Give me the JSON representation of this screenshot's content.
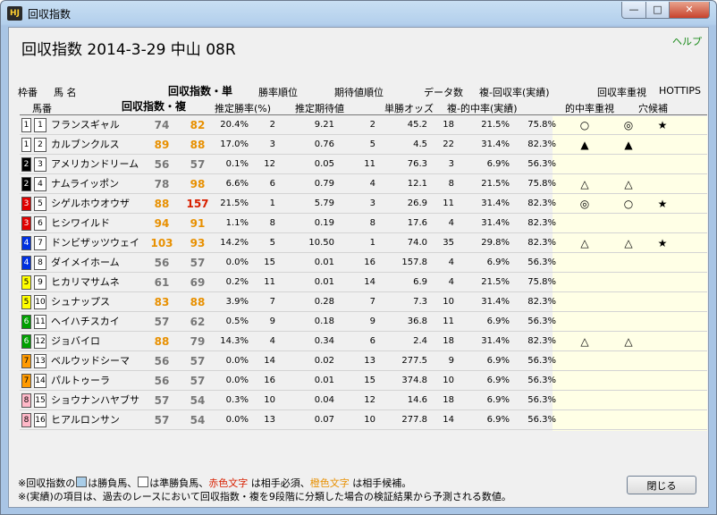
{
  "window": {
    "title": "回収指数",
    "icon_label": "HJ",
    "minimize": "—",
    "maximize": "□",
    "close": "✕"
  },
  "header": {
    "title": "回収指数  2014-3-29 中山 08R",
    "help": "ヘルプ"
  },
  "columns_top": {
    "waku": "枠番",
    "horse": "馬 名",
    "idx_single": "回収指数・単",
    "win_rank": "勝率順位",
    "exp_rank": "期待値順位",
    "data_count": "データ数",
    "place_recov": "複-回収率(実績)",
    "recov_focus": "回収率重視",
    "hottips": "HOTTIPS"
  },
  "columns_bottom": {
    "umaban": "馬番",
    "idx_place": "回収指数・複",
    "est_win": "推定勝率(%)",
    "est_exp": "推定期待値",
    "odds": "単勝オッズ",
    "place_hit": "複-的中率(実績)",
    "hit_focus": "的中率重視",
    "longshot": "穴候補"
  },
  "colors": {
    "red": "#d82000",
    "orange": "#e89000",
    "gray": "#777777"
  },
  "rows": [
    {
      "waku": "1",
      "waku_bg": "#ffffff",
      "waku_fg": "#000000",
      "umaban": "1",
      "name": "フランスギャル",
      "idx1": "74",
      "idx1_c": "gray",
      "idx2": "82",
      "idx2_c": "orange",
      "winp": "20.4%",
      "winr": "2",
      "exp": "9.21",
      "expr": "2",
      "odds": "45.2",
      "cnt": "18",
      "hit": "21.5%",
      "recov": "75.8%",
      "s1": "○",
      "s2": "◎",
      "s3": "★"
    },
    {
      "waku": "1",
      "waku_bg": "#ffffff",
      "waku_fg": "#000000",
      "umaban": "2",
      "name": "カルブンクルス",
      "idx1": "89",
      "idx1_c": "orange",
      "idx2": "88",
      "idx2_c": "orange",
      "winp": "17.0%",
      "winr": "3",
      "exp": "0.76",
      "expr": "5",
      "odds": "4.5",
      "cnt": "22",
      "hit": "31.4%",
      "recov": "82.3%",
      "s1": "▲",
      "s2": "▲",
      "s3": ""
    },
    {
      "waku": "2",
      "waku_bg": "#000000",
      "waku_fg": "#ffffff",
      "umaban": "3",
      "name": "アメリカンドリーム",
      "idx1": "56",
      "idx1_c": "gray",
      "idx2": "57",
      "idx2_c": "gray",
      "winp": "0.1%",
      "winr": "12",
      "exp": "0.05",
      "expr": "11",
      "odds": "76.3",
      "cnt": "3",
      "hit": "6.9%",
      "recov": "56.3%",
      "s1": "",
      "s2": "",
      "s3": ""
    },
    {
      "waku": "2",
      "waku_bg": "#000000",
      "waku_fg": "#ffffff",
      "umaban": "4",
      "name": "ナムライッポン",
      "idx1": "78",
      "idx1_c": "gray",
      "idx2": "98",
      "idx2_c": "orange",
      "winp": "6.6%",
      "winr": "6",
      "exp": "0.79",
      "expr": "4",
      "odds": "12.1",
      "cnt": "8",
      "hit": "21.5%",
      "recov": "75.8%",
      "s1": "△",
      "s2": "△",
      "s3": ""
    },
    {
      "waku": "3",
      "waku_bg": "#e00000",
      "waku_fg": "#ffffff",
      "umaban": "5",
      "name": "シゲルホウオウザ",
      "idx1": "88",
      "idx1_c": "orange",
      "idx2": "157",
      "idx2_c": "red",
      "winp": "21.5%",
      "winr": "1",
      "exp": "5.79",
      "expr": "3",
      "odds": "26.9",
      "cnt": "11",
      "hit": "31.4%",
      "recov": "82.3%",
      "s1": "◎",
      "s2": "○",
      "s3": "★"
    },
    {
      "waku": "3",
      "waku_bg": "#e00000",
      "waku_fg": "#ffffff",
      "umaban": "6",
      "name": "ヒシワイルド",
      "idx1": "94",
      "idx1_c": "orange",
      "idx2": "91",
      "idx2_c": "orange",
      "winp": "1.1%",
      "winr": "8",
      "exp": "0.19",
      "expr": "8",
      "odds": "17.6",
      "cnt": "4",
      "hit": "31.4%",
      "recov": "82.3%",
      "s1": "",
      "s2": "",
      "s3": ""
    },
    {
      "waku": "4",
      "waku_bg": "#0030e0",
      "waku_fg": "#ffffff",
      "umaban": "7",
      "name": "ドンビザッツウェイ",
      "idx1": "103",
      "idx1_c": "orange",
      "idx2": "93",
      "idx2_c": "orange",
      "winp": "14.2%",
      "winr": "5",
      "exp": "10.50",
      "expr": "1",
      "odds": "74.0",
      "cnt": "35",
      "hit": "29.8%",
      "recov": "82.3%",
      "s1": "△",
      "s2": "△",
      "s3": "★"
    },
    {
      "waku": "4",
      "waku_bg": "#0030e0",
      "waku_fg": "#ffffff",
      "umaban": "8",
      "name": "ダイメイホーム",
      "idx1": "56",
      "idx1_c": "gray",
      "idx2": "57",
      "idx2_c": "gray",
      "winp": "0.0%",
      "winr": "15",
      "exp": "0.01",
      "expr": "16",
      "odds": "157.8",
      "cnt": "4",
      "hit": "6.9%",
      "recov": "56.3%",
      "s1": "",
      "s2": "",
      "s3": ""
    },
    {
      "waku": "5",
      "waku_bg": "#ffff00",
      "waku_fg": "#000000",
      "umaban": "9",
      "name": "ヒカリマサムネ",
      "idx1": "61",
      "idx1_c": "gray",
      "idx2": "69",
      "idx2_c": "gray",
      "winp": "0.2%",
      "winr": "11",
      "exp": "0.01",
      "expr": "14",
      "odds": "6.9",
      "cnt": "4",
      "hit": "21.5%",
      "recov": "75.8%",
      "s1": "",
      "s2": "",
      "s3": ""
    },
    {
      "waku": "5",
      "waku_bg": "#ffff00",
      "waku_fg": "#000000",
      "umaban": "10",
      "name": "シュナップス",
      "idx1": "83",
      "idx1_c": "orange",
      "idx2": "88",
      "idx2_c": "orange",
      "winp": "3.9%",
      "winr": "7",
      "exp": "0.28",
      "expr": "7",
      "odds": "7.3",
      "cnt": "10",
      "hit": "31.4%",
      "recov": "82.3%",
      "s1": "",
      "s2": "",
      "s3": ""
    },
    {
      "waku": "6",
      "waku_bg": "#00a000",
      "waku_fg": "#ffffff",
      "umaban": "11",
      "name": "ヘイハチスカイ",
      "idx1": "57",
      "idx1_c": "gray",
      "idx2": "62",
      "idx2_c": "gray",
      "winp": "0.5%",
      "winr": "9",
      "exp": "0.18",
      "expr": "9",
      "odds": "36.8",
      "cnt": "11",
      "hit": "6.9%",
      "recov": "56.3%",
      "s1": "",
      "s2": "",
      "s3": ""
    },
    {
      "waku": "6",
      "waku_bg": "#00a000",
      "waku_fg": "#ffffff",
      "umaban": "12",
      "name": "ジョバイロ",
      "idx1": "88",
      "idx1_c": "orange",
      "idx2": "79",
      "idx2_c": "gray",
      "winp": "14.3%",
      "winr": "4",
      "exp": "0.34",
      "expr": "6",
      "odds": "2.4",
      "cnt": "18",
      "hit": "31.4%",
      "recov": "82.3%",
      "s1": "△",
      "s2": "△",
      "s3": ""
    },
    {
      "waku": "7",
      "waku_bg": "#ff9a00",
      "waku_fg": "#000000",
      "umaban": "13",
      "name": "ベルウッドシーマ",
      "idx1": "56",
      "idx1_c": "gray",
      "idx2": "57",
      "idx2_c": "gray",
      "winp": "0.0%",
      "winr": "14",
      "exp": "0.02",
      "expr": "13",
      "odds": "277.5",
      "cnt": "9",
      "hit": "6.9%",
      "recov": "56.3%",
      "s1": "",
      "s2": "",
      "s3": ""
    },
    {
      "waku": "7",
      "waku_bg": "#ff9a00",
      "waku_fg": "#000000",
      "umaban": "14",
      "name": "パルトゥーラ",
      "idx1": "56",
      "idx1_c": "gray",
      "idx2": "57",
      "idx2_c": "gray",
      "winp": "0.0%",
      "winr": "16",
      "exp": "0.01",
      "expr": "15",
      "odds": "374.8",
      "cnt": "10",
      "hit": "6.9%",
      "recov": "56.3%",
      "s1": "",
      "s2": "",
      "s3": ""
    },
    {
      "waku": "8",
      "waku_bg": "#ffb8c8",
      "waku_fg": "#000000",
      "umaban": "15",
      "name": "ショウナンハヤブサ",
      "idx1": "57",
      "idx1_c": "gray",
      "idx2": "54",
      "idx2_c": "gray",
      "winp": "0.3%",
      "winr": "10",
      "exp": "0.04",
      "expr": "12",
      "odds": "14.6",
      "cnt": "18",
      "hit": "6.9%",
      "recov": "56.3%",
      "s1": "",
      "s2": "",
      "s3": ""
    },
    {
      "waku": "8",
      "waku_bg": "#ffb8c8",
      "waku_fg": "#000000",
      "umaban": "16",
      "name": "ヒアルロンサン",
      "idx1": "57",
      "idx1_c": "gray",
      "idx2": "54",
      "idx2_c": "gray",
      "winp": "0.0%",
      "winr": "13",
      "exp": "0.07",
      "expr": "10",
      "odds": "277.8",
      "cnt": "14",
      "hit": "6.9%",
      "recov": "56.3%",
      "s1": "",
      "s2": "",
      "s3": ""
    }
  ],
  "footer": {
    "l1_a": "※回収指数の",
    "l1_b": "は勝負馬、",
    "l1_c": "は準勝負馬、",
    "l1_red": "赤色文字",
    "l1_d": " は相手必須、",
    "l1_orange": "橙色文字",
    "l1_e": " は相手候補。",
    "l2": "※(実績)の項目は、過去のレースにおいて回収指数・複を9段階に分類した場合の検証結果から予測される数値。",
    "close_button": "閉じる"
  }
}
